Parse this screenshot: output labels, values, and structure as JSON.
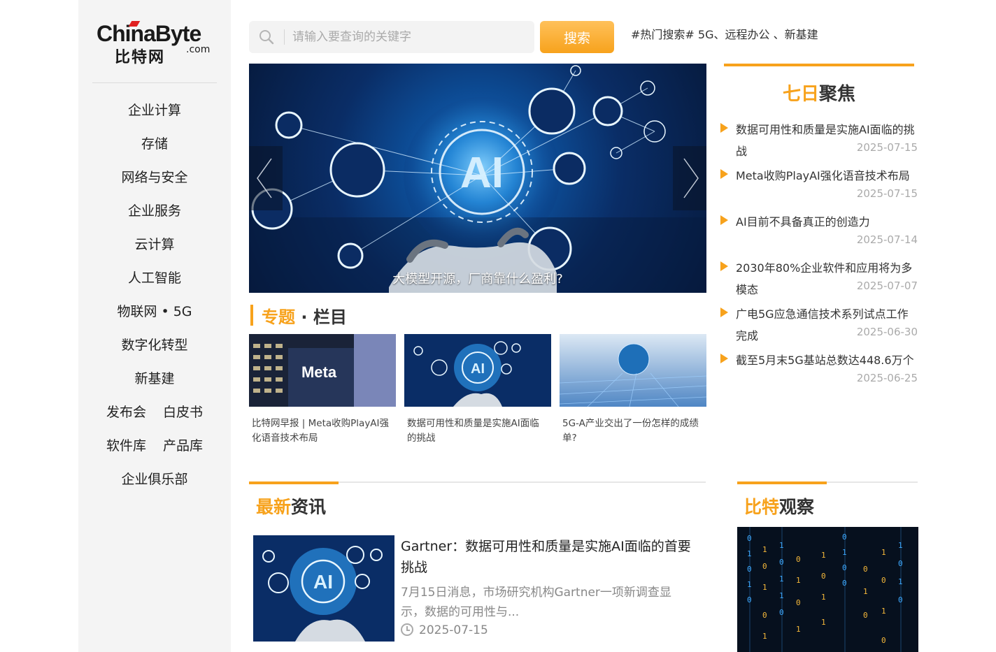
{
  "logo": {
    "main": "ChinaByte",
    "cn": "比特网",
    "com": ".com"
  },
  "nav": {
    "items": [
      "企业计算",
      "存储",
      "网络与安全",
      "企业服务",
      "云计算",
      "人工智能",
      "物联网 • 5G",
      "数字化转型",
      "新基建"
    ],
    "pair1": [
      "发布会",
      "白皮书"
    ],
    "pair2": [
      "软件库",
      "产品库"
    ],
    "last": "企业俱乐部"
  },
  "search": {
    "placeholder": "请输入要查询的关键字",
    "button": "搜索",
    "hot": "#热门搜索# 5G、远程办公 、新基建"
  },
  "banner": {
    "title": "大模型开源，厂商靠什么盈利?",
    "center_text": "AI"
  },
  "topic": {
    "title_accent": "专题",
    "title_rest": " · 栏目",
    "cards": [
      {
        "text": "比特网早报 | Meta收购PlayAI强化语音技术布局",
        "img_label": "Meta"
      },
      {
        "text": "数据可用性和质量是实施AI面临的挑战",
        "img_label": "AI"
      },
      {
        "text": "5G-A产业交出了一份怎样的成绩单?",
        "img_label": ""
      }
    ]
  },
  "focus": {
    "title_accent": "七日",
    "title_rest": "聚焦",
    "items": [
      {
        "text": "数据可用性和质量是实施AI面临的挑战",
        "date": "2025-07-15"
      },
      {
        "text": "Meta收购PlayAI强化语音技术布局",
        "date": "2025-07-15"
      },
      {
        "text": "AI目前不具备真正的创造力",
        "date": "2025-07-14"
      },
      {
        "text": "2030年80%企业软件和应用将为多模态",
        "date": "2025-07-07"
      },
      {
        "text": "广电5G应急通信技术系列试点工作完成",
        "date": "2025-06-30"
      },
      {
        "text": "截至5月末5G基站总数达448.6万个",
        "date": "2025-06-25"
      }
    ]
  },
  "news": {
    "title_accent": "最新",
    "title_rest": "资讯",
    "headline": "Gartner：数据可用性和质量是实施AI面临的首要挑战",
    "summary": "7月15日消息，市场研究机构Gartner一项新调查显示，数据的可用性与...",
    "date": "2025-07-15",
    "img_label": "AI"
  },
  "observe": {
    "title_accent": "比特",
    "title_rest": "观察"
  },
  "colors": {
    "accent": "#f7a21c",
    "sidebar_bg": "#f4f4f4",
    "banner_bg": "#0a2d66"
  }
}
